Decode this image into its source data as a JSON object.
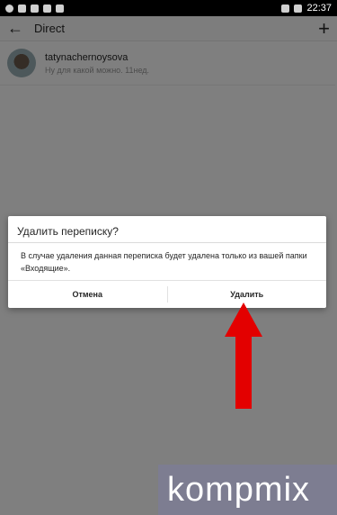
{
  "status_bar": {
    "time": "22:37"
  },
  "top_bar": {
    "title": "Direct"
  },
  "thread": {
    "username": "tatynachernoysova",
    "snippet": "Ну для какой можно. 11нед."
  },
  "dialog": {
    "title": "Удалить переписку?",
    "message": "В случае удаления данная переписка будет удалена только из вашей папки «Входящие».",
    "cancel_label": "Отмена",
    "delete_label": "Удалить"
  },
  "annotation": {
    "arrow_color": "#e30000"
  },
  "watermark": {
    "text": "kompmix"
  }
}
